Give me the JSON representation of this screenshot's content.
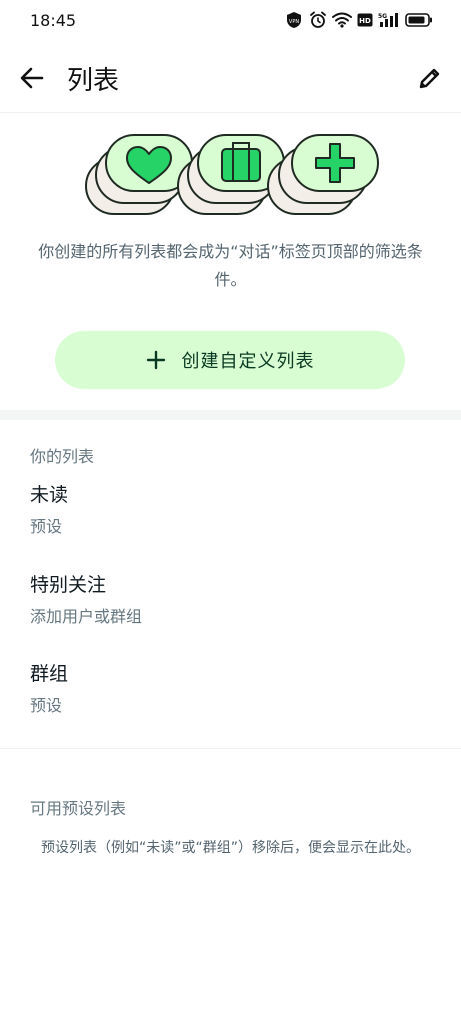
{
  "status_bar": {
    "time": "18:45",
    "icons": [
      "vpn-icon",
      "alarm-icon",
      "wifi-icon",
      "hd-icon",
      "signal-5g-icon",
      "battery-icon"
    ],
    "hd_label": "HD",
    "vpn_label": "VPN",
    "net_label": "5G"
  },
  "header": {
    "title": "列表",
    "back_icon": "arrow-left-icon",
    "edit_icon": "pencil-icon"
  },
  "hero": {
    "description": "你创建的所有列表都会成为“对话”标签页顶部的筛选条件。",
    "create_button_label": "创建自定义列表",
    "icons": [
      "heart-icon",
      "briefcase-icon",
      "plus-icon"
    ]
  },
  "your_lists": {
    "section_title": "你的列表",
    "items": [
      {
        "title": "未读",
        "subtitle": "预设"
      },
      {
        "title": "特别关注",
        "subtitle": "添加用户或群组"
      },
      {
        "title": "群组",
        "subtitle": "预设"
      }
    ]
  },
  "available_presets": {
    "section_title": "可用预设列表",
    "description": "预设列表（例如“未读”或“群组”）移除后，便会显示在此处。"
  },
  "colors": {
    "accent_green": "#1daa61",
    "pill_bg": "#d9fdd3",
    "icon_green": "#25d366",
    "outline": "#1f2b22",
    "text_primary": "#111b21",
    "text_secondary": "#667781"
  }
}
